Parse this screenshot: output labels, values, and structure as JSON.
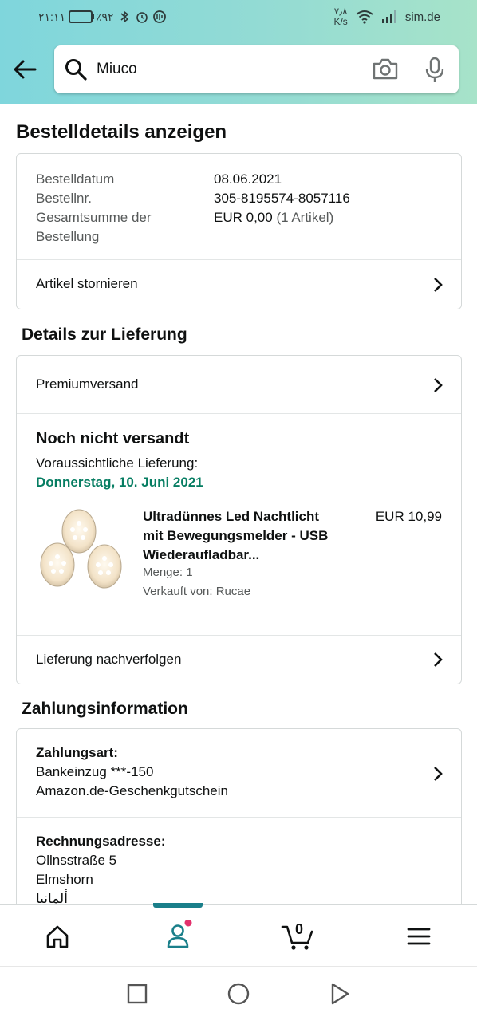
{
  "statusbar": {
    "time": "٢١:١١",
    "battery": "٪٩٢",
    "speed_value": "٧٫٨",
    "speed_unit": "K/s",
    "carrier": "sim.de"
  },
  "search": {
    "value": "Miuco"
  },
  "page_title": "Bestelldetails anzeigen",
  "order": {
    "date_label": "Bestelldatum",
    "date_value": "08.06.2021",
    "number_label": "Bestellnr.",
    "number_value": "305-8195574-8057116",
    "total_label_1": "Gesamtsumme der",
    "total_label_2": "Bestellung",
    "total_value": "EUR 0,00",
    "total_count": "(1 Artikel)",
    "cancel_label": "Artikel stornieren"
  },
  "delivery": {
    "section_title": "Details zur Lieferung",
    "shipping_method": "Premiumversand",
    "status": "Noch nicht versandt",
    "expected_label": "Voraussichtliche Lieferung:",
    "expected_date": "Donnerstag, 10. Juni 2021",
    "product_line1": "Ultradünnes Led Nachtlicht",
    "product_line2": "mit Bewegungsmelder - USB",
    "product_line3": "Wiederaufladbar...",
    "price": "EUR 10,99",
    "quantity": "Menge: 1",
    "seller": "Verkauft von: Rucae",
    "track_label": "Lieferung nachverfolgen"
  },
  "payment": {
    "section_title": "Zahlungsinformation",
    "method_label": "Zahlungsart:",
    "method_line1": "Bankeinzug ***-150",
    "method_line2": "Amazon.de-Geschenkgutschein",
    "address_label": "Rechnungsadresse:",
    "address_line1": "Ollnsstraße 5",
    "address_line2": "Elmshorn",
    "address_line3": "ألمانيا"
  },
  "cart_count": "0",
  "colors": {
    "accent_teal": "#1a7f8a",
    "delivery_green": "#067d62",
    "badge_pink": "#e3306c"
  }
}
